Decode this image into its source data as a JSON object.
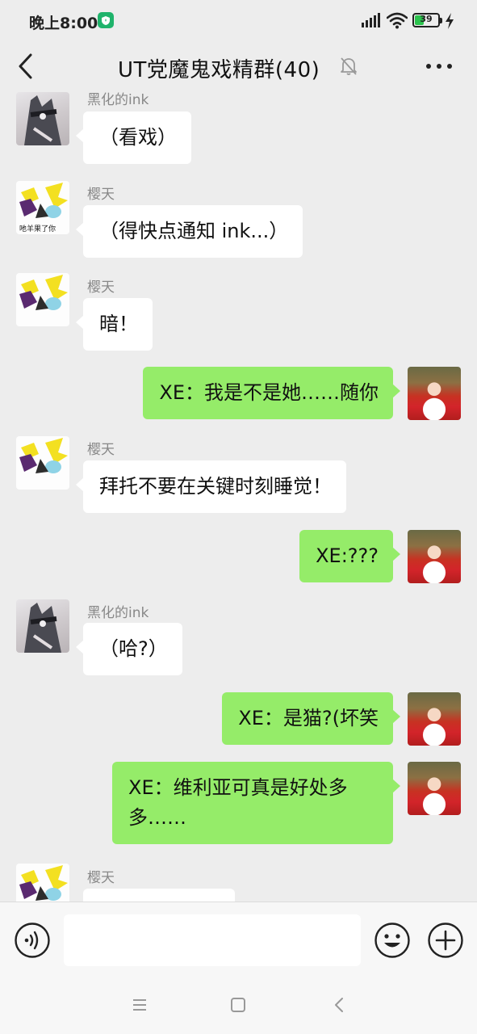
{
  "status_bar": {
    "time": "晚上8:00",
    "battery_level": "39",
    "battery_fraction": 0.39,
    "icons": [
      "shield-icon",
      "signal-icon",
      "wifi-icon",
      "battery-icon",
      "charging-icon"
    ]
  },
  "header": {
    "title": "UT党魔鬼戏精群(40)",
    "icons": [
      "back-icon",
      "mute-icon",
      "more-icon"
    ]
  },
  "messages": [
    {
      "sender": "黑化的ink",
      "text": "（看戏）"
    },
    {
      "sender": "樱天",
      "text": "（得快点通知 ink...）"
    },
    {
      "sender": "樱天",
      "text": "暗！"
    },
    {
      "sender": "me",
      "text": "XE：我是不是她……随你"
    },
    {
      "sender": "樱天",
      "text": "拜托不要在关键时刻睡觉！"
    },
    {
      "sender": "me",
      "text": "XE:???"
    },
    {
      "sender": "黑化的ink",
      "text": "（哈?）"
    },
    {
      "sender": "me",
      "text": "XE：是猫?(坏笑"
    },
    {
      "sender": "me",
      "text_line1": "XE：维利亚可真是好处多",
      "text_line2": "多……"
    },
    {
      "sender": "樱天",
      "text": ""
    }
  ],
  "avatar_caption": "吔羊果了你",
  "input_bar": {
    "placeholder": "",
    "icons": [
      "voice-icon",
      "emoji-icon",
      "plus-icon"
    ]
  },
  "system_nav": {
    "icons": [
      "menu-icon",
      "home-icon",
      "back-icon"
    ]
  },
  "colors": {
    "background": "#ededed",
    "bubble_in": "#ffffff",
    "bubble_out": "#95ec69",
    "sender_name": "#888888"
  }
}
